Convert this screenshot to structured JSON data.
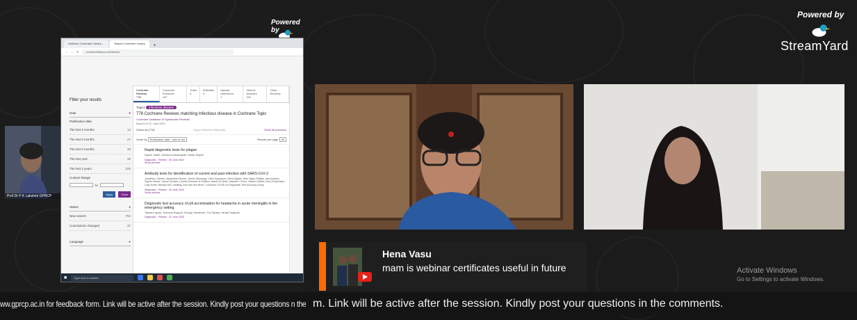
{
  "branding": {
    "powered_by": "Powered by",
    "streamyard": "StreamYard"
  },
  "screenshare": {
    "tabs": [
      "Outlook | Cochrane Library ... ",
      "Search Cochrane Library"
    ],
    "address": "cochranelibrary.com/search",
    "filter": {
      "title": "Filter your results",
      "date_section": "Date",
      "date_label": "Publication date",
      "date_rows": [
        {
          "label": "The last 3 months",
          "count": "13"
        },
        {
          "label": "The last 6 months",
          "count": "27"
        },
        {
          "label": "The last 9 months",
          "count": "30"
        },
        {
          "label": "The last year",
          "count": "39"
        },
        {
          "label": "The last 2 years",
          "count": "105"
        }
      ],
      "custom_range": "Custom Range",
      "to_label": "to",
      "apply": "Apply",
      "clear": "Clear",
      "status_section": "Status",
      "status_rows": [
        {
          "label": "New search",
          "count": "792"
        },
        {
          "label": "Conclusions changed",
          "count": "37"
        }
      ],
      "language_section": "Language"
    },
    "results": {
      "tabs": [
        {
          "label": "Cochrane Reviews",
          "count": "778"
        },
        {
          "label": "Cochrane Protocols",
          "count": "167"
        },
        {
          "label": "Trials",
          "count": "4"
        },
        {
          "label": "Editorials",
          "count": "3"
        },
        {
          "label": "Special collections",
          "count": "1"
        },
        {
          "label": "Clinical Answers",
          "count": "201"
        },
        {
          "label": "Other Reviews",
          "count": ""
        }
      ],
      "topic_prefix": "Topics",
      "topic": "Infectious disease",
      "heading": "778 Cochrane Reviews matching Infectious disease in Cochrane Topic",
      "database": "Cochrane Database of Systematic Reviews",
      "issue": "Issue 6 of 12, June 2020",
      "select_all": "Select all (778)",
      "export": "Export selected citation(s)",
      "show_previews": "Show all previews",
      "order_by": "Order by",
      "order_value": "Publication date : new to old",
      "per_page": "Results per page",
      "per_page_value": "25",
      "items": [
        {
          "title": "Rapid diagnostic tests for plague",
          "authors": "Sophie Jullien, Hendra A Dissanayake, Marty Chaplin",
          "type": "Diagnostic · Review · 25 June 2020",
          "preview": "Show preview"
        },
        {
          "title": "Antibody tests for identification of current and past infection with SARS-CoV-2",
          "authors": "Jonathan J Deeks, Jacqueline Dinnes, Yemisi Takwoingi, Clare Davenport, René Spijker, Sian Taylor-Phillips, Ada Adriano, Sophie Beese, Janine Dretzke, Lavinia Ferrante di Ruffano, Isobel M Harris, Malcolm J Price, Sabine Dittrich, Devy Emperador, Lotty Hooft, Mariska MG Leeflang, Ann Van den Bruel, Cochrane COVID-19 Diagnostic Test Accuracy Group",
          "type": "Diagnostic · Review · 25 June 2020",
          "preview": "Show preview"
        },
        {
          "title": "Diagnostic test accuracy of jolt accentuation for headache in acute meningitis in the emergency setting",
          "authors": "Takahiro Iguchi, Yoshinori Noguchi, Shungo Yamamoto, Yuu Tanaka, Hiroaki Tsujimoto",
          "type": "Diagnostic · Review · 22 June 2020",
          "preview": "Show preview"
        }
      ]
    },
    "taskbar_search": "Type here to search"
  },
  "small_cam_label": "Prof Dr P K Lakshmi GPRCP",
  "comment": {
    "name": "Hena Vasu",
    "text": "mam is webinar certificates useful in future"
  },
  "windows_activation": {
    "title": "Activate Windows",
    "subtitle": "Go to Settings to activate Windows."
  },
  "ticker": {
    "left": "ww.gprcp.ac.in for feedback form. Link will be active after the session. Kindly post your questions n the",
    "right": "m. Link will be active after the session. Kindly post your questions in the comments."
  },
  "colors": {
    "accent": "#ff6a00",
    "youtube": "#e62117",
    "cochrane_purple": "#7a2a8a"
  }
}
